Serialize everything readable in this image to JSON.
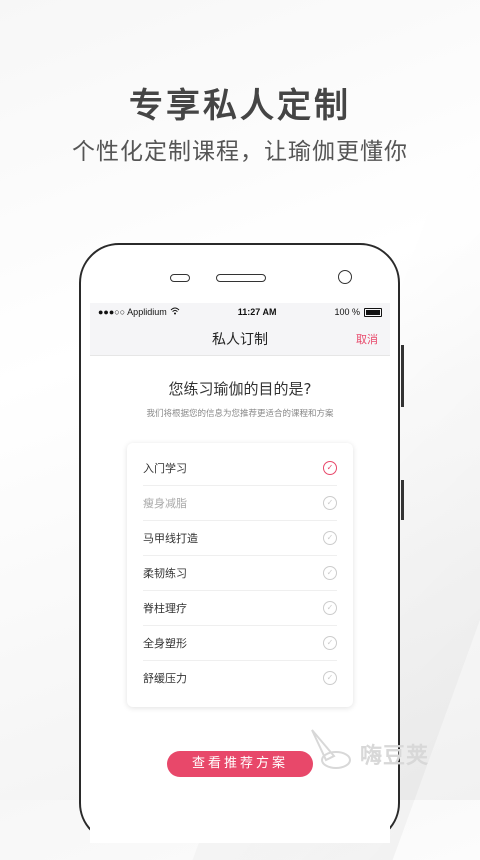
{
  "promo": {
    "headline": "专享私人定制",
    "subline": "个性化定制课程，让瑜伽更懂你"
  },
  "status_bar": {
    "carrier": "●●●○○ Applidium",
    "time": "11:27 AM",
    "battery_text": "100 %"
  },
  "nav": {
    "title": "私人订制",
    "cancel_label": "取消"
  },
  "question": {
    "title": "您练习瑜伽的目的是?",
    "hint": "我们将根据您的信息为您推荐更适合的课程和方案"
  },
  "options": [
    {
      "label": "入门学习",
      "selected": true
    },
    {
      "label": "瘦身减脂",
      "selected": false
    },
    {
      "label": "马甲线打造",
      "selected": false
    },
    {
      "label": "柔韧练习",
      "selected": false
    },
    {
      "label": "脊柱理疗",
      "selected": false
    },
    {
      "label": "全身塑形",
      "selected": false
    },
    {
      "label": "舒缓压力",
      "selected": false
    }
  ],
  "cta": {
    "label": "查看推荐方案"
  },
  "watermark": {
    "text": "嗨豆荚"
  },
  "colors": {
    "accent": "#e8486a",
    "text": "#333333",
    "muted": "#888888"
  }
}
